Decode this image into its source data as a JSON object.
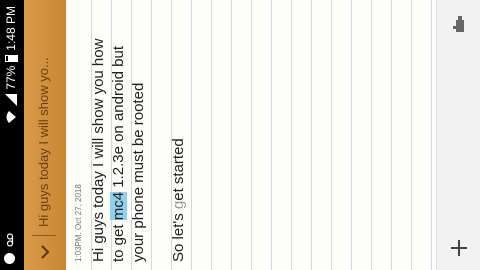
{
  "status_bar": {
    "time": "1:48 PM",
    "battery_percent": "77%",
    "battery_level": 0.77,
    "icons": [
      "notification-dot-icon",
      "voicemail-icon",
      "wifi-icon",
      "signal-icon",
      "battery-icon"
    ]
  },
  "toolbar": {
    "title": "Hi guys today I will show yo...",
    "accent_color": "#d0903e"
  },
  "note": {
    "timestamp": "1:03PM, Oct 27, 2018",
    "lines": [
      "Hi guys today I will show you how",
      "to get ",
      " 1.2.3e on android but",
      "your phone must be rooted"
    ],
    "highlight_word": "mc4",
    "closing_parts": [
      "So let's ",
      "g",
      "et started"
    ],
    "highlight_color": "#8ed0ee"
  },
  "bottom_bar": {
    "add_icon": "plus-icon",
    "edit_icon": "edit-mode-icon"
  }
}
